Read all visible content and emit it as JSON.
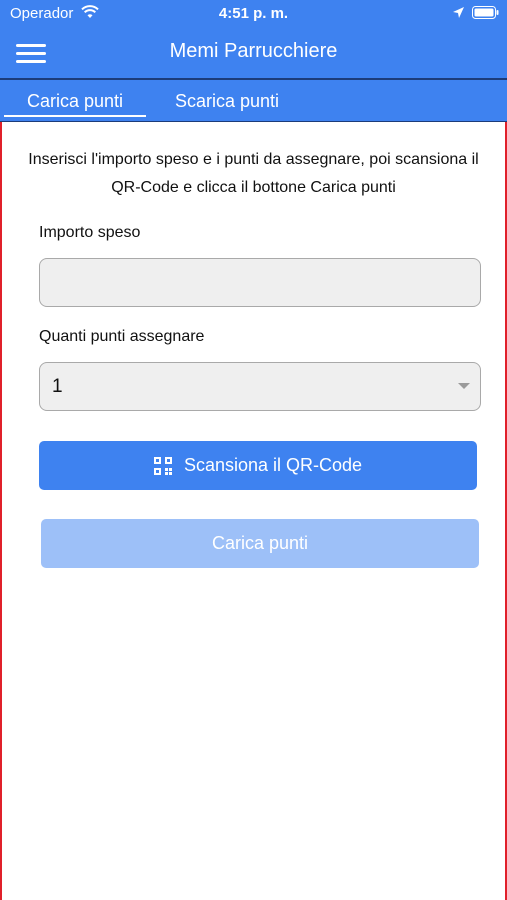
{
  "status_bar": {
    "carrier": "Operador",
    "time": "4:51 p. m."
  },
  "navbar": {
    "title": "Memi Parrucchiere"
  },
  "tabs": [
    {
      "label": "Carica punti",
      "active": true
    },
    {
      "label": "Scarica punti",
      "active": false
    }
  ],
  "form": {
    "instructions": "Inserisci l'importo speso e i punti da assegnare, poi scansiona il QR-Code e clicca il bottone Carica punti",
    "amount_label": "Importo speso",
    "amount_value": "",
    "points_label": "Quanti punti assegnare",
    "points_value": "1",
    "scan_button_label": "Scansiona il QR-Code",
    "load_button_label": "Carica punti"
  },
  "colors": {
    "primary": "#3e82f0",
    "primary_disabled": "#9dc0f8",
    "border_accent": "#e0202a"
  },
  "icons": [
    "wifi-icon",
    "location-icon",
    "battery-icon",
    "menu-icon",
    "chevron-down-icon",
    "qr-code-icon"
  ]
}
